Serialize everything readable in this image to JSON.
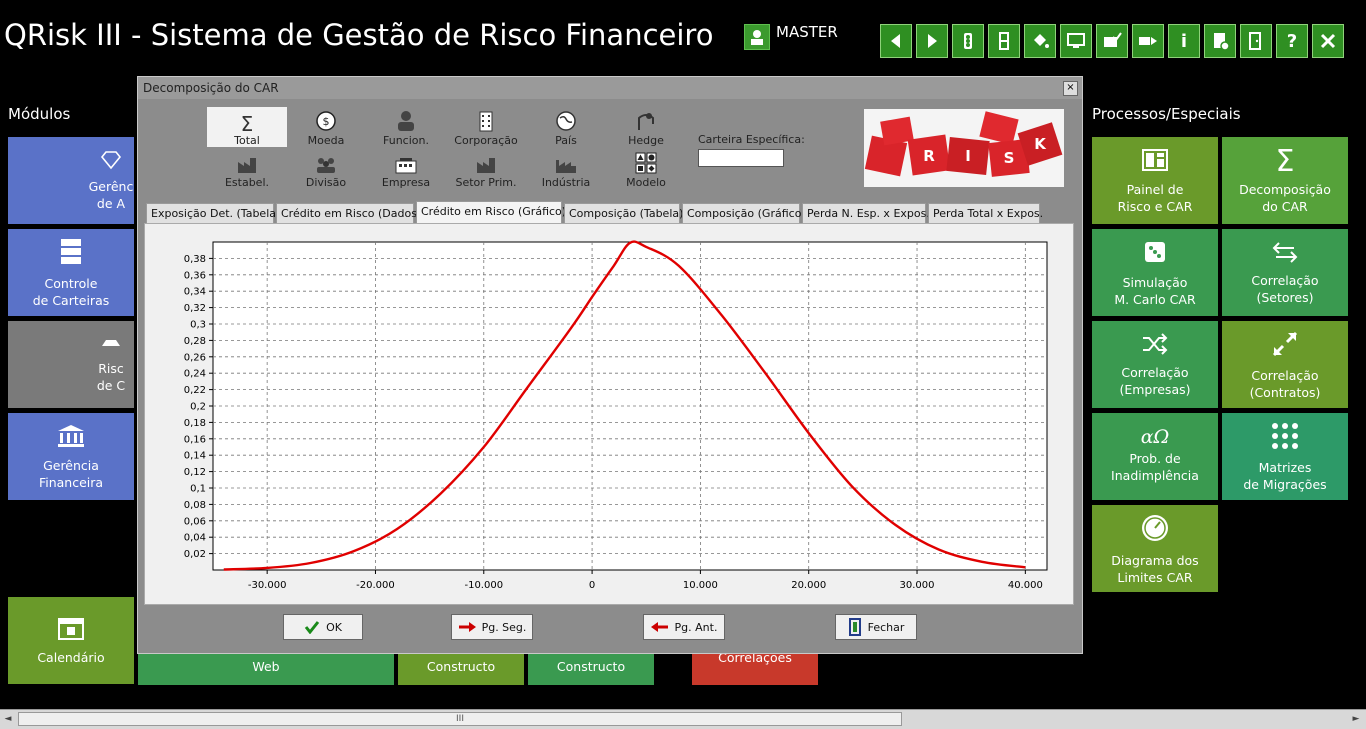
{
  "app": {
    "title": "QRisk III - Sistema de Gestão de Risco Financeiro",
    "user": "MASTER"
  },
  "toolbar": {
    "icons": [
      "arrow-left-icon",
      "arrow-right-icon",
      "traffic-light-icon",
      "column-icon",
      "paint-bucket-icon",
      "monitor-icon",
      "mail-check-icon",
      "mail-forward-icon",
      "info-icon",
      "document-help-icon",
      "exit-door-icon",
      "help-icon",
      "close-icon"
    ],
    "info": "i",
    "help": "?"
  },
  "left": {
    "header": "Módulos",
    "tiles": [
      {
        "label": "Gerênc\nde A",
        "icon": "diamond-icon"
      },
      {
        "label": "Controle\nde Carteiras",
        "icon": "server-icon"
      },
      {
        "label": "Risc\nde  C",
        "icon": "car-icon"
      },
      {
        "label": "Gerência\nFinanceira",
        "icon": "bank-icon"
      },
      {
        "label": "Calendário",
        "icon": "calendar-icon"
      }
    ],
    "bottom_tiles": [
      "Web",
      "Constructo",
      "Constructo",
      "Correlações"
    ]
  },
  "right": {
    "header": "Processos/Especiais",
    "tiles": [
      {
        "label": "Painel de\nRisco e CAR",
        "icon": "panel-icon"
      },
      {
        "label": "Decomposição\ndo CAR",
        "icon": "sigma-icon"
      },
      {
        "label": "Simulação\nM. Carlo CAR",
        "icon": "dice-icon"
      },
      {
        "label": "Correlação\n(Setores)",
        "icon": "arrows-exchange-icon"
      },
      {
        "label": "Correlação\n(Empresas)",
        "icon": "shuffle-icon"
      },
      {
        "label": "Correlação\n(Contratos)",
        "icon": "arrows-diagonal-icon"
      },
      {
        "label": "Prob. de\nInadimplência",
        "icon": "alpha-omega-icon",
        "symbol": "αΩ"
      },
      {
        "label": "Matrizes\nde Migrações",
        "icon": "dots-grid-icon"
      },
      {
        "label": "Diagrama dos\nLimites CAR",
        "icon": "gauge-icon"
      }
    ],
    "sigma": "Σ"
  },
  "dialog": {
    "title": "Decomposição do CAR",
    "close": "×",
    "filters_row1": [
      "Total",
      "Moeda",
      "Funcion.",
      "Corporação",
      "País",
      "Hedge"
    ],
    "filters_row2": [
      "Estabel.",
      "Divisão",
      "Empresa",
      "Setor Prim.",
      "Indústria",
      "Modelo"
    ],
    "carteira_label": "Carteira Específica:",
    "carteira_value": "",
    "logo_letters": [
      "R",
      "I",
      "S",
      "K"
    ],
    "tabs": [
      "Exposição Det. (Tabela)",
      "Crédito em Risco (Dados)",
      "Crédito em Risco (Gráfico)",
      "Composição (Tabela)",
      "Composição (Gráfico)",
      "Perda N. Esp. x Expos.",
      "Perda Total x Expos."
    ],
    "active_tab": 2,
    "buttons": {
      "ok": "OK",
      "next": "Pg. Seg.",
      "prev": "Pg. Ant.",
      "close": "Fechar"
    }
  },
  "scrollbar": {
    "grip": "III"
  },
  "colors": {
    "curve": "#e00000",
    "tile_blue": "#5a72c8",
    "tile_gray": "#7a7a7a",
    "tile_green": "#6a9a2a",
    "tile_red": "#c8392b"
  },
  "chart_data": {
    "type": "line",
    "title": "",
    "xlabel": "",
    "ylabel": "",
    "xlim": [
      -35000,
      42000
    ],
    "ylim": [
      0,
      0.4
    ],
    "x_ticks": [
      -30000,
      -20000,
      -10000,
      0,
      10000,
      20000,
      30000,
      40000
    ],
    "x_tick_labels": [
      "-30.000",
      "-20.000",
      "-10.000",
      "0",
      "10.000",
      "20.000",
      "30.000",
      "40.000"
    ],
    "y_ticks": [
      0.02,
      0.04,
      0.06,
      0.08,
      0.1,
      0.12,
      0.14,
      0.16,
      0.18,
      0.2,
      0.22,
      0.24,
      0.26,
      0.28,
      0.3,
      0.32,
      0.34,
      0.36,
      0.38
    ],
    "y_tick_labels": [
      "0,02",
      "0,04",
      "0,06",
      "0,08",
      "0,1",
      "0,12",
      "0,14",
      "0,16",
      "0,18",
      "0,2",
      "0,22",
      "0,24",
      "0,26",
      "0,28",
      "0,3",
      "0,32",
      "0,34",
      "0,36",
      "0,38"
    ],
    "grid": true,
    "legend": "none",
    "series": [
      {
        "x": [
          -34000,
          -30000,
          -26000,
          -22000,
          -18000,
          -14000,
          -10000,
          -6000,
          -2000,
          0,
          2000,
          3500,
          5000,
          8000,
          12000,
          16000,
          20000,
          24000,
          28000,
          32000,
          36000,
          40000
        ],
        "y": [
          0.0006,
          0.0025,
          0.0085,
          0.023,
          0.05,
          0.093,
          0.15,
          0.222,
          0.294,
          0.333,
          0.371,
          0.399,
          0.394,
          0.371,
          0.31,
          0.24,
          0.167,
          0.102,
          0.055,
          0.025,
          0.01,
          0.0033
        ]
      }
    ]
  }
}
